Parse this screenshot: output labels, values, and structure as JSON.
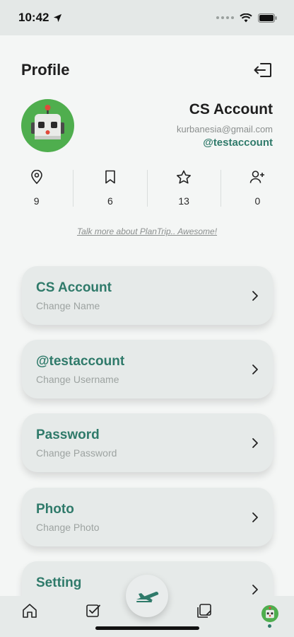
{
  "status_bar": {
    "time": "10:42"
  },
  "header": {
    "title": "Profile",
    "logout_icon": "logout-icon"
  },
  "profile": {
    "name": "CS Account",
    "email": "kurbanesia@gmail.com",
    "handle": "@testaccount",
    "avatar_icon": "robot-avatar"
  },
  "stats": [
    {
      "icon": "location-pin-icon",
      "value": "9"
    },
    {
      "icon": "bookmark-icon",
      "value": "6"
    },
    {
      "icon": "star-icon",
      "value": "13"
    },
    {
      "icon": "add-user-icon",
      "value": "0"
    }
  ],
  "tagline": "Talk more about PlanTrip.. Awesome!",
  "menu": [
    {
      "title": "CS Account",
      "subtitle": "Change Name"
    },
    {
      "title": "@testaccount",
      "subtitle": "Change Username"
    },
    {
      "title": "Password",
      "subtitle": "Change Password"
    },
    {
      "title": "Photo",
      "subtitle": "Change Photo"
    },
    {
      "title": "Setting",
      "subtitle": ""
    }
  ],
  "bottom_nav": {
    "items": [
      "home-icon",
      "checklist-icon",
      "plane-icon",
      "notes-icon",
      "profile-avatar"
    ],
    "active": "profile-avatar"
  },
  "colors": {
    "accent": "#2f7a6a",
    "avatar_bg": "#4fae4e",
    "card_bg": "#e6eae9"
  }
}
